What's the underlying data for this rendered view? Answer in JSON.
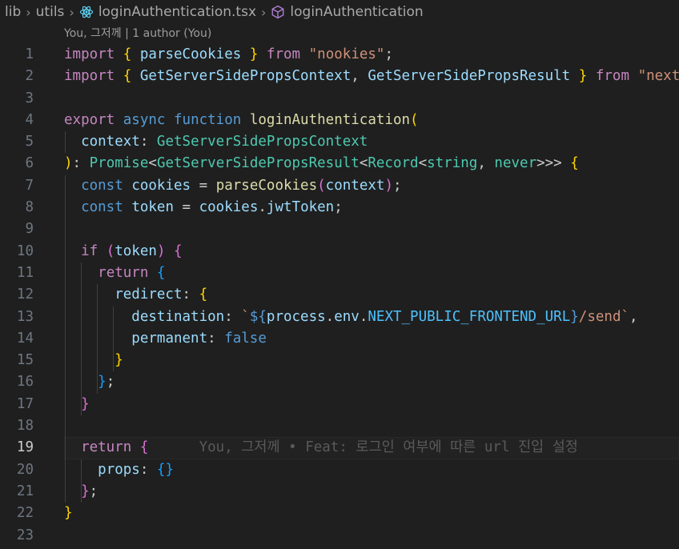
{
  "breadcrumb": {
    "items": [
      "lib",
      "utils",
      "loginAuthentication.tsx",
      "loginAuthentication"
    ]
  },
  "codelens": "You, 그저께 | 1 author (You)",
  "blame": "You, 그저께 • Feat: 로그인 여부에 따른 url 진입 설정",
  "active_line": 19,
  "lines": [
    [
      [
        "k",
        "import"
      ],
      [
        "p",
        " "
      ],
      [
        "y",
        "{"
      ],
      [
        "p",
        " "
      ],
      [
        "v",
        "parseCookies"
      ],
      [
        "p",
        " "
      ],
      [
        "y",
        "}"
      ],
      [
        "p",
        " "
      ],
      [
        "k",
        "from"
      ],
      [
        "p",
        " "
      ],
      [
        "s",
        "\"nookies\""
      ],
      [
        "p",
        ";"
      ]
    ],
    [
      [
        "k",
        "import"
      ],
      [
        "p",
        " "
      ],
      [
        "y",
        "{"
      ],
      [
        "p",
        " "
      ],
      [
        "v",
        "GetServerSidePropsContext"
      ],
      [
        "p",
        ", "
      ],
      [
        "v",
        "GetServerSidePropsResult"
      ],
      [
        "p",
        " "
      ],
      [
        "y",
        "}"
      ],
      [
        "p",
        " "
      ],
      [
        "k",
        "from"
      ],
      [
        "p",
        " "
      ],
      [
        "s",
        "\"next\""
      ],
      [
        "p",
        ";"
      ]
    ],
    [],
    [
      [
        "k",
        "export"
      ],
      [
        "p",
        " "
      ],
      [
        "b",
        "async"
      ],
      [
        "p",
        " "
      ],
      [
        "b",
        "function"
      ],
      [
        "p",
        " "
      ],
      [
        "f",
        "loginAuthentication"
      ],
      [
        "y",
        "("
      ]
    ],
    [
      [
        "p",
        "  "
      ],
      [
        "v",
        "context"
      ],
      [
        "p",
        ": "
      ],
      [
        "t",
        "GetServerSidePropsContext"
      ]
    ],
    [
      [
        "y",
        ")"
      ],
      [
        "p",
        ": "
      ],
      [
        "t",
        "Promise"
      ],
      [
        "p",
        "<"
      ],
      [
        "t",
        "GetServerSidePropsResult"
      ],
      [
        "p",
        "<"
      ],
      [
        "t",
        "Record"
      ],
      [
        "p",
        "<"
      ],
      [
        "t",
        "string"
      ],
      [
        "p",
        ", "
      ],
      [
        "t",
        "never"
      ],
      [
        "p",
        ">>> "
      ],
      [
        "y",
        "{"
      ]
    ],
    [
      [
        "p",
        "  "
      ],
      [
        "b",
        "const"
      ],
      [
        "p",
        " "
      ],
      [
        "v",
        "cookies"
      ],
      [
        "p",
        " = "
      ],
      [
        "f",
        "parseCookies"
      ],
      [
        "m",
        "("
      ],
      [
        "v",
        "context"
      ],
      [
        "m",
        ")"
      ],
      [
        "p",
        ";"
      ]
    ],
    [
      [
        "p",
        "  "
      ],
      [
        "b",
        "const"
      ],
      [
        "p",
        " "
      ],
      [
        "v",
        "token"
      ],
      [
        "p",
        " = "
      ],
      [
        "v",
        "cookies"
      ],
      [
        "p",
        "."
      ],
      [
        "v",
        "jwtToken"
      ],
      [
        "p",
        ";"
      ]
    ],
    [],
    [
      [
        "p",
        "  "
      ],
      [
        "k",
        "if"
      ],
      [
        "p",
        " "
      ],
      [
        "m",
        "("
      ],
      [
        "v",
        "token"
      ],
      [
        "m",
        ")"
      ],
      [
        "p",
        " "
      ],
      [
        "m",
        "{"
      ]
    ],
    [
      [
        "p",
        "    "
      ],
      [
        "k",
        "return"
      ],
      [
        "p",
        " "
      ],
      [
        "c",
        "{"
      ]
    ],
    [
      [
        "p",
        "      "
      ],
      [
        "v",
        "redirect"
      ],
      [
        "p",
        ": "
      ],
      [
        "y",
        "{"
      ]
    ],
    [
      [
        "p",
        "        "
      ],
      [
        "v",
        "destination"
      ],
      [
        "p",
        ": "
      ],
      [
        "s",
        "`"
      ],
      [
        "b",
        "${"
      ],
      [
        "v",
        "process"
      ],
      [
        "p",
        "."
      ],
      [
        "v",
        "env"
      ],
      [
        "p",
        "."
      ],
      [
        "const",
        "NEXT_PUBLIC_FRONTEND_URL"
      ],
      [
        "b",
        "}"
      ],
      [
        "s",
        "/send`"
      ],
      [
        "p",
        ","
      ]
    ],
    [
      [
        "p",
        "        "
      ],
      [
        "v",
        "permanent"
      ],
      [
        "p",
        ": "
      ],
      [
        "b",
        "false"
      ]
    ],
    [
      [
        "p",
        "      "
      ],
      [
        "y",
        "}"
      ]
    ],
    [
      [
        "p",
        "    "
      ],
      [
        "c",
        "}"
      ],
      [
        "p",
        ";"
      ]
    ],
    [
      [
        "p",
        "  "
      ],
      [
        "m",
        "}"
      ]
    ],
    [],
    [
      [
        "p",
        "  "
      ],
      [
        "k",
        "return"
      ],
      [
        "p",
        " "
      ],
      [
        "m",
        "{"
      ]
    ],
    [
      [
        "p",
        "    "
      ],
      [
        "v",
        "props"
      ],
      [
        "p",
        ": "
      ],
      [
        "c",
        "{}"
      ]
    ],
    [
      [
        "p",
        "  "
      ],
      [
        "m",
        "}"
      ],
      [
        "p",
        ";"
      ]
    ],
    [
      [
        "y",
        "}"
      ]
    ],
    []
  ]
}
